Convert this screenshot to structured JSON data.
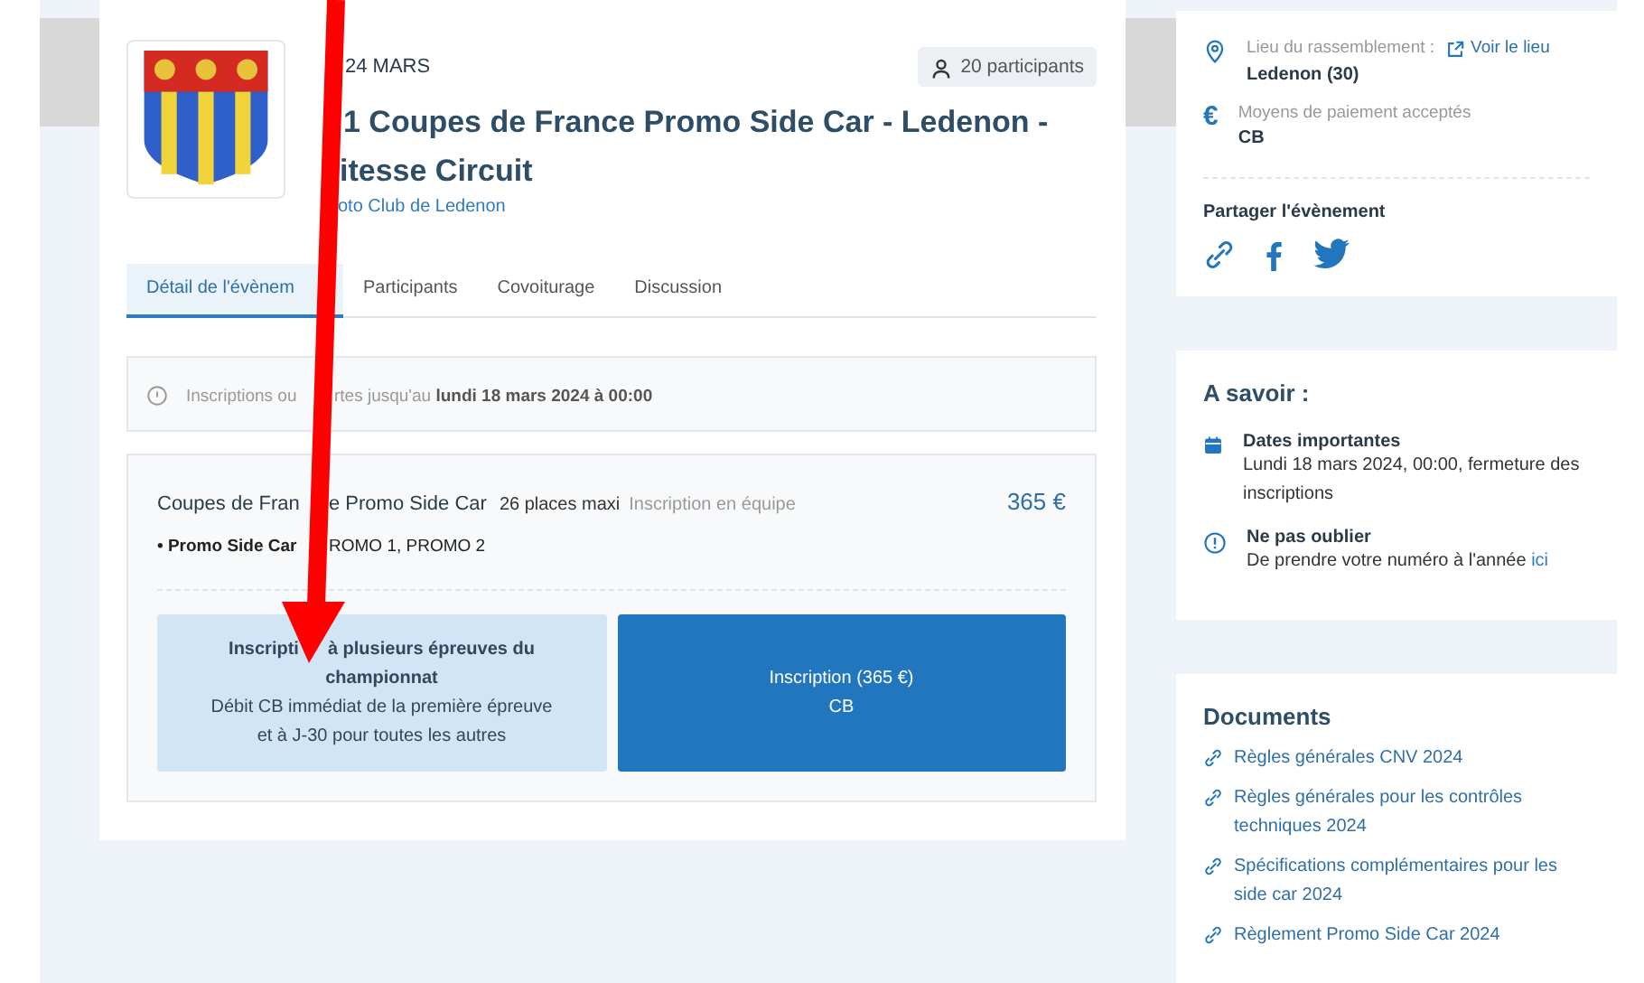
{
  "event": {
    "date": "24 MARS",
    "title_lines": [
      "1 Coupes de France Promo Side Car - Ledenon -",
      "itesse Circuit"
    ],
    "organizer": "oto Club de Ledenon",
    "participants": "20 participants"
  },
  "tabs": [
    {
      "label": "Détail de l'évènem",
      "selected": true
    },
    {
      "label": "Participants",
      "selected": false
    },
    {
      "label": "Covoiturage",
      "selected": false
    },
    {
      "label": "Discussion",
      "selected": false
    }
  ],
  "notice": [
    "Inscriptions ou",
    "rtes jusqu'au **lundi 18 mars 2024 à 00:00**"
  ],
  "offer": {
    "title": [
      "Coupes de Fran",
      "e Promo Side Car"
    ],
    "places": "26 places maxi",
    "type": "Inscription en équipe",
    "price": "365 €",
    "category": [
      "• Promo Side Car",
      "ROMO 1, PROMO 2"
    ],
    "buttons": [
      {
        "kind": "light",
        "lines": [
          {
            "parts": [
              "Inscripti",
              "à plusieurs épreuves du"
            ],
            "bold": true
          },
          {
            "parts": [
              "championnat"
            ],
            "bold": true
          },
          {
            "parts": [
              "Débit CB immédiat de la première épreuve"
            ],
            "bold": false
          },
          {
            "parts": [
              "et à J-30 pour toutes les autres"
            ],
            "bold": false
          }
        ]
      },
      {
        "kind": "primary",
        "lines": [
          {
            "parts": [
              "Inscription (365 €)"
            ],
            "bold": false
          },
          {
            "parts": [
              "CB"
            ],
            "bold": false
          }
        ]
      }
    ]
  },
  "info": {
    "place_label": "Lieu du rassemblement :",
    "place_link": "Voir le lieu",
    "place": "Ledenon (30)",
    "currency_symbol": "€",
    "payment_label": "Moyens de paiement acceptés",
    "payment": "CB",
    "share": "Partager l'évènement"
  },
  "a_savoir": {
    "title": "A savoir :",
    "items": [
      {
        "kind": "calendar",
        "title": "Dates importantes",
        "text": "Lundi 18 mars 2024, 00:00, fermeture des inscriptions"
      },
      {
        "kind": "alert",
        "title": "Ne pas oublier",
        "text": "De prendre votre numéro à l'année ",
        "link": "ici"
      }
    ]
  },
  "documents": {
    "title": "Documents",
    "items": [
      "Règles générales CNV 2024",
      "Règles générales pour les contrôles techniques 2024",
      "Spécifications complémentaires pour les side car 2024",
      "Règlement Promo Side Car 2024"
    ]
  }
}
